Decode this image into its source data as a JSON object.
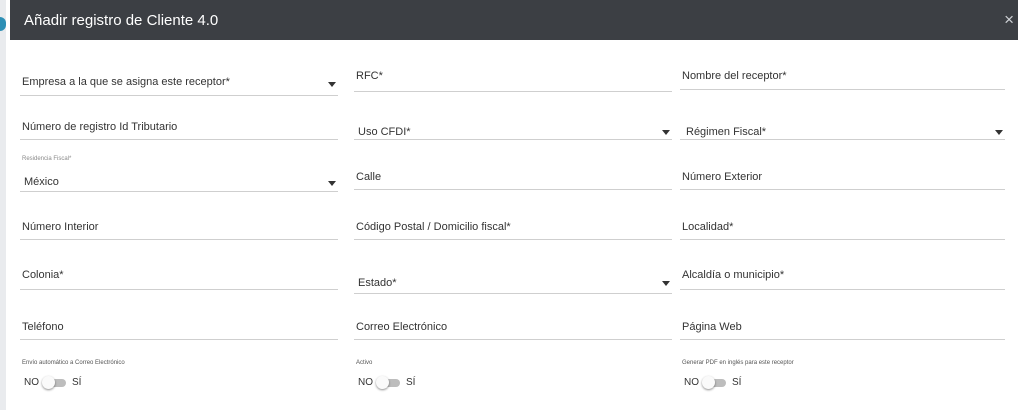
{
  "modal": {
    "title": "Añadir registro de Cliente 4.0",
    "close_glyph": "×"
  },
  "fields": {
    "empresa": "Empresa a la que se asigna este receptor*",
    "rfc": "RFC*",
    "nombre_receptor": "Nombre del receptor*",
    "numero_registro": "Número de registro Id Tributario",
    "uso_cfdi": "Uso CFDI*",
    "regimen_fiscal": "Régimen Fiscal*",
    "residencia_fiscal_label": "Residencia Fiscal*",
    "residencia_fiscal_value": "México",
    "calle": "Calle",
    "numero_exterior": "Número Exterior",
    "numero_interior": "Número Interior",
    "codigo_postal": "Código Postal / Domicilio fiscal*",
    "localidad": "Localidad*",
    "colonia": "Colonia*",
    "estado": "Estado*",
    "alcaldia": "Alcaldía o municipio*",
    "telefono": "Teléfono",
    "correo": "Correo Electrónico",
    "pagina_web": "Página Web"
  },
  "toggles": {
    "envio_label": "Envío automático a Correo Electrónico",
    "activo_label": "Activo",
    "pdf_ingles_label": "Generar PDF en inglés para este receptor",
    "no": "NO",
    "si": "SÍ"
  },
  "colors": {
    "header_bg": "#3c3f44",
    "header_text": "#ffffff",
    "underline": "#cfcfcf",
    "switch_track": "#bdbdbd",
    "accent": "#2d8fb5"
  }
}
